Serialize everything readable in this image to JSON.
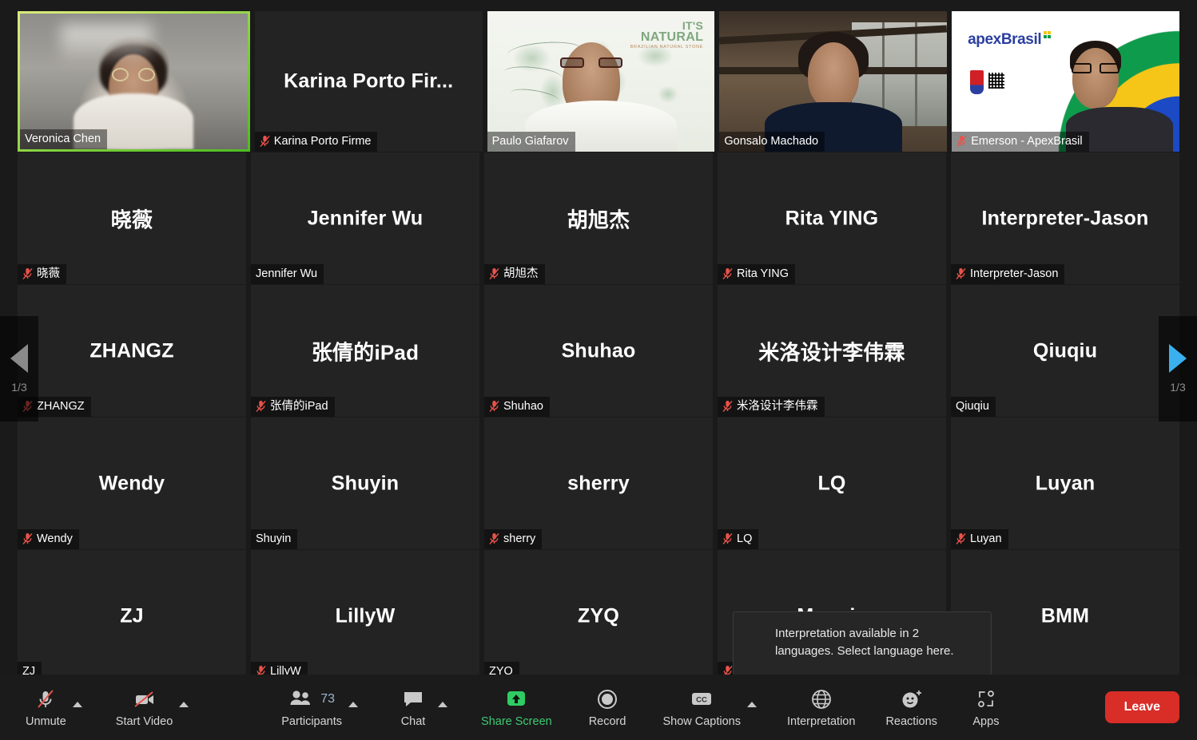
{
  "meeting": {
    "active_speaker": "Veronica Chen",
    "page_indicator_left": "1/3",
    "page_indicator_right": "1/3"
  },
  "tooltip": {
    "text": "Interpretation available in 2 languages. Select language here."
  },
  "colors": {
    "active_border": "#b9e05f",
    "leave_button": "#d92d28",
    "share_screen_green": "#3ec973",
    "mute_red": "#e8534a",
    "next_arrow_blue": "#3ab0ef",
    "prev_arrow_gray": "#8a8a8a",
    "tile_bg": "#232323",
    "app_bg": "#1a1a1a"
  },
  "rows": [
    {
      "tiles": [
        {
          "name": "Veronica Chen",
          "label": "Veronica Chen",
          "muted": false,
          "video": true,
          "active": true,
          "kind": "veronica"
        },
        {
          "name": "Karina Porto Fir...",
          "label": "Karina Porto Firme",
          "muted": true,
          "video": false,
          "active": false,
          "kind": "name"
        },
        {
          "name": "Paulo Giafarov",
          "label": "Paulo Giafarov",
          "muted": false,
          "video": true,
          "active": false,
          "kind": "paulo"
        },
        {
          "name": "Gonsalo Machado",
          "label": "Gonsalo Machado",
          "muted": false,
          "video": true,
          "active": false,
          "kind": "gonsalo"
        },
        {
          "name": "Emerson - ApexBrasil",
          "label": "Emerson - ApexBrasil",
          "muted": true,
          "video": true,
          "active": false,
          "kind": "emerson"
        }
      ]
    },
    {
      "tiles": [
        {
          "name": "晓薇",
          "label": "晓薇",
          "muted": true,
          "video": false,
          "active": false,
          "kind": "name",
          "cjk": true
        },
        {
          "name": "Jennifer Wu",
          "label": "Jennifer Wu",
          "muted": false,
          "video": false,
          "active": false,
          "kind": "name"
        },
        {
          "name": "胡旭杰",
          "label": "胡旭杰",
          "muted": true,
          "video": false,
          "active": false,
          "kind": "name",
          "cjk": true
        },
        {
          "name": "Rita YING",
          "label": "Rita YING",
          "muted": true,
          "video": false,
          "active": false,
          "kind": "name"
        },
        {
          "name": "Interpreter-Jason",
          "label": "Interpreter-Jason",
          "muted": true,
          "video": false,
          "active": false,
          "kind": "name"
        }
      ]
    },
    {
      "tiles": [
        {
          "name": "ZHANGZ",
          "label": "ZHANGZ",
          "muted": true,
          "video": false,
          "active": false,
          "kind": "name"
        },
        {
          "name": "张倩的iPad",
          "label": "张倩的iPad",
          "muted": true,
          "video": false,
          "active": false,
          "kind": "name",
          "cjk": true
        },
        {
          "name": "Shuhao",
          "label": "Shuhao",
          "muted": true,
          "video": false,
          "active": false,
          "kind": "name"
        },
        {
          "name": "米洛设计李伟霖",
          "label": "米洛设计李伟霖",
          "muted": true,
          "video": false,
          "active": false,
          "kind": "name",
          "cjk": true
        },
        {
          "name": "Qiuqiu",
          "label": "Qiuqiu",
          "muted": false,
          "video": false,
          "active": false,
          "kind": "name"
        }
      ]
    },
    {
      "tiles": [
        {
          "name": "Wendy",
          "label": "Wendy",
          "muted": true,
          "video": false,
          "active": false,
          "kind": "name"
        },
        {
          "name": "Shuyin",
          "label": "Shuyin",
          "muted": false,
          "video": false,
          "active": false,
          "kind": "name"
        },
        {
          "name": "sherry",
          "label": "sherry",
          "muted": true,
          "video": false,
          "active": false,
          "kind": "name"
        },
        {
          "name": "LQ",
          "label": "LQ",
          "muted": true,
          "video": false,
          "active": false,
          "kind": "name"
        },
        {
          "name": "Luyan",
          "label": "Luyan",
          "muted": true,
          "video": false,
          "active": false,
          "kind": "name"
        }
      ]
    },
    {
      "tiles": [
        {
          "name": "ZJ",
          "label": "ZJ",
          "muted": false,
          "video": false,
          "active": false,
          "kind": "name"
        },
        {
          "name": "LillyW",
          "label": "LillyW",
          "muted": true,
          "video": false,
          "active": false,
          "kind": "name"
        },
        {
          "name": "ZYQ",
          "label": "ZYQ",
          "muted": false,
          "video": false,
          "active": false,
          "kind": "name"
        },
        {
          "name": "Maggie",
          "label": "Maggie",
          "muted": true,
          "video": false,
          "active": false,
          "kind": "name"
        },
        {
          "name": "BMM",
          "label": "BMM",
          "muted": false,
          "video": false,
          "active": false,
          "kind": "name"
        }
      ]
    }
  ],
  "toolbar": {
    "unmute_label": "Unmute",
    "start_video_label": "Start Video",
    "participants_label": "Participants",
    "participants_count": "73",
    "chat_label": "Chat",
    "share_screen_label": "Share Screen",
    "record_label": "Record",
    "show_captions_label": "Show Captions",
    "captions_badge": "cc",
    "interpretation_label": "Interpretation",
    "reactions_label": "Reactions",
    "apps_label": "Apps",
    "leave_label": "Leave"
  },
  "branding": {
    "paulo_line1": "IT'S",
    "paulo_line2": "NATURAL",
    "paulo_line3": "BRAZILIAN NATURAL STONE",
    "emerson_wordmark": "apexBrasil"
  }
}
